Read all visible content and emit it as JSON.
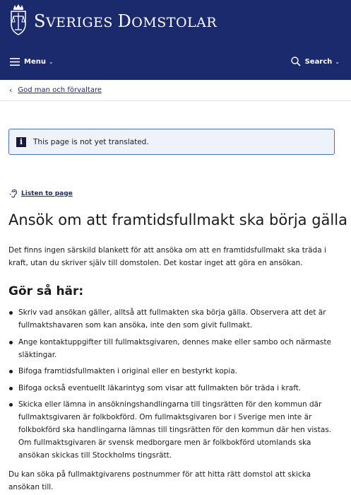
{
  "header": {
    "logo_text_first": "S",
    "logo_text_rest": "VERIGES ",
    "logo_text_first2": "D",
    "logo_text_rest2": "OMSTOLAR",
    "menu_label": "Menu",
    "search_label": "Search",
    "background": "#1a2a6c"
  },
  "breadcrumb": {
    "label": "God man och förvaltare"
  },
  "notice": {
    "text": "This page is not yet translated."
  },
  "listen": {
    "label": "Listen to page"
  },
  "main": {
    "title": "Ansök om att framtidsfullmakt ska börja gälla",
    "intro": "Det finns ingen särskild blankett för att ansöka om att en framtidsfullmakt ska träda i kraft, utan du skriver själv till domstolen. Det kostar inget att göra en ansökan.",
    "howto_heading": "Gör så här:",
    "steps": [
      "Skriv vad ansökan gäller, alltså att fullmakten ska börja gälla. Observera att det är fullmaktshavaren som kan ansöka, inte den som givit fullmakt.",
      "Ange kontaktuppgifter till fullmaktsgivaren, dennes make eller sambo och närmaste släktingar.",
      "Bifoga framtidsfullmakten i original eller en bestyrkt kopia.",
      "Bifoga också eventuellt läkarintyg som visar att fullmakten bör träda i kraft.",
      "Skicka eller lämna in ansökningshandlingarna till tingsrätten för den kommun där fullmaktsgivaren är folkbokförd. Om fullmaktsgivaren bor i Sverige men inte är folkbokförd ska handlingarna lämnas till tingsrätten för den kommun där hen vistas. Om fullmaktsgivaren är svensk medborgare men är folkbokförd utomlands ska ansökan skickas till Stockholms tingsrätt."
    ],
    "outro": "Du kan söka på fullmaktgivarens postnummer för att hitta rätt domstol att skicka ansökan till."
  }
}
